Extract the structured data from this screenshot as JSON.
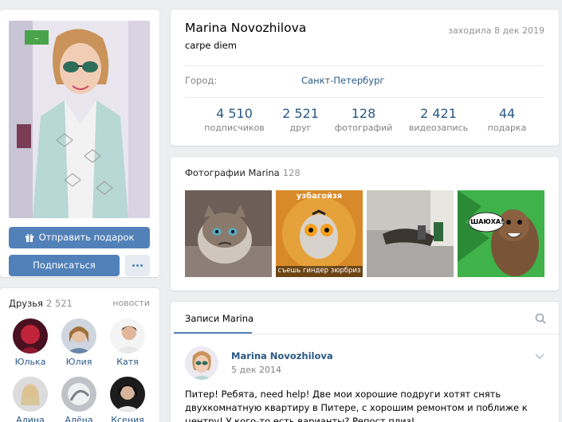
{
  "profile": {
    "name": "Marina Novozhilova",
    "status": "carpe diem",
    "last_seen": "заходила 8 дек 2019",
    "city_label": "Город:",
    "city_value": "Санкт-Петербург",
    "counters": [
      {
        "value": "4 510",
        "label": "подписчиков"
      },
      {
        "value": "2 521",
        "label": "друг"
      },
      {
        "value": "128",
        "label": "фотографий"
      },
      {
        "value": "2 421",
        "label": "видеозапись"
      },
      {
        "value": "44",
        "label": "подарка"
      }
    ]
  },
  "left": {
    "gift_button": "Отправить подарок",
    "subscribe_button": "Подписаться"
  },
  "friends": {
    "title": "Друзья",
    "count": "2 521",
    "all_link": "новости",
    "items": [
      {
        "name": "Юлька"
      },
      {
        "name": "Юлия"
      },
      {
        "name": "Катя"
      },
      {
        "name": "Алина"
      },
      {
        "name": "Алёна"
      },
      {
        "name": "Ксения"
      }
    ]
  },
  "photos": {
    "title": "Фотографии Marina",
    "count": "128",
    "meme_top": "узбагойзя",
    "meme_bottom": "съешь гиндер зюрбриз",
    "bear_text": "ШАЮХА!"
  },
  "posts": {
    "tab_label": "Записи Marina",
    "author": "Marina Novozhilova",
    "date": "5 дек 2014",
    "text": "Питер! Ребята, need help! Две мои хорошие подруги хотят снять двухкомнатную квартиру в Питере, с хорошим ремонтом и поближе к центру! У кого-то есть варианты? Репост плиз!"
  },
  "icons": {
    "gift": "gift-icon",
    "more": "more-dots-icon",
    "search": "search-icon",
    "chevron": "chevron-down-icon"
  },
  "colors": {
    "accent": "#5181b8",
    "link": "#2a5885",
    "background": "#edeef0"
  }
}
